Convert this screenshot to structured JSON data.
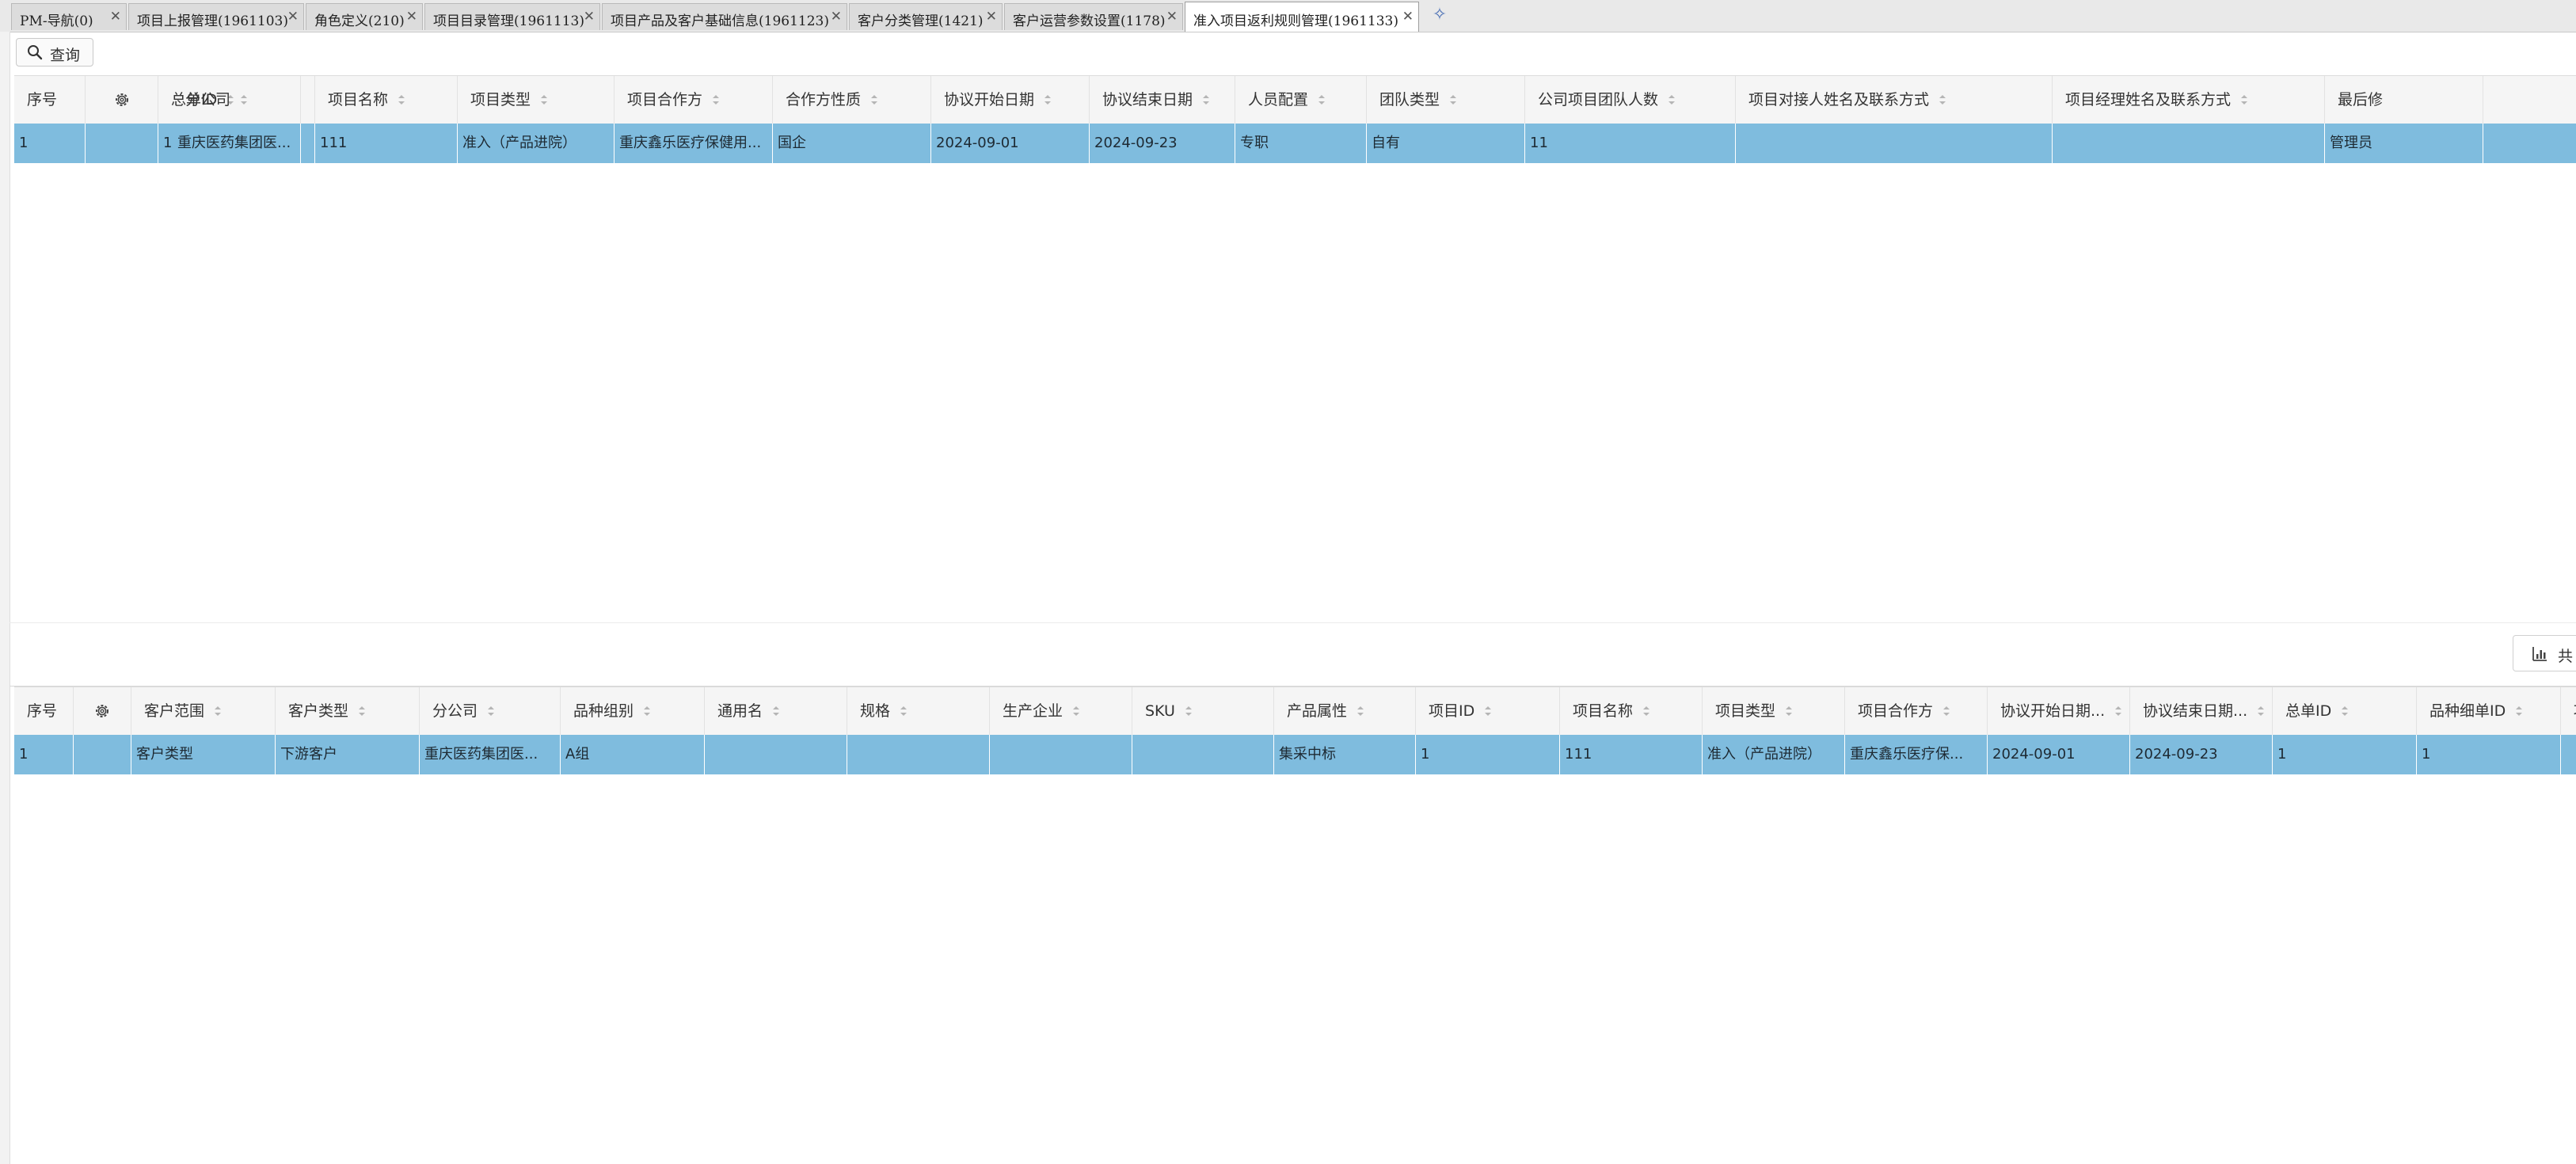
{
  "tabs": [
    {
      "label": "PM-导航(0)",
      "close": "✕"
    },
    {
      "label": "项目上报管理(1961103)",
      "close": "✕"
    },
    {
      "label": "角色定义(210)",
      "close": "✕"
    },
    {
      "label": "项目目录管理(1961113)",
      "close": "✕"
    },
    {
      "label": "项目产品及客户基础信息(1961123)",
      "close": "✕"
    },
    {
      "label": "客户分类管理(1421)",
      "close": "✕"
    },
    {
      "label": "客户运营参数设置(1178)",
      "close": "✕"
    },
    {
      "label": "准入项目返利规则管理(1961133)",
      "close": "✕"
    }
  ],
  "add_tab_icon": "✧",
  "toolbar": {
    "query_label": "查询",
    "query_icon": "search-icon"
  },
  "grid_top": {
    "columns": [
      "序号",
      "",
      "总单ID",
      "分公司",
      "项目名称",
      "项目类型",
      "项目合作方",
      "合作方性质",
      "协议开始日期",
      "协议结束日期",
      "人员配置",
      "团队类型",
      "公司项目团队人数",
      "项目对接人姓名及联系方式",
      "项目经理姓名及联系方式",
      "最后修"
    ],
    "rows": [
      [
        "1",
        "",
        "1",
        "重庆医药集团医...",
        "111",
        "准入（产品进院）",
        "重庆鑫乐医疗保健用...",
        "国企",
        "2024-09-01",
        "2024-09-23",
        "专职",
        "自有",
        "11",
        "",
        "",
        "管理员"
      ]
    ]
  },
  "stats_button": {
    "label": "共",
    "icon": "bar-chart-icon"
  },
  "grid_bottom": {
    "columns": [
      "序号",
      "",
      "客户范围",
      "客户类型",
      "分公司",
      "品种组别",
      "通用名",
      "规格",
      "生产企业",
      "SKU",
      "产品属性",
      "项目ID",
      "项目名称",
      "项目类型",
      "项目合作方",
      "协议开始日期...",
      "协议结束日期...",
      "总单ID",
      "品种细单ID",
      "项"
    ],
    "rows": [
      [
        "1",
        "",
        "客户类型",
        "下游客户",
        "重庆医药集团医...",
        "A组",
        "",
        "",
        "",
        "",
        "集采中标",
        "1",
        "111",
        "准入（产品进院）",
        "重庆鑫乐医疗保...",
        "2024-09-01",
        "2024-09-23",
        "1",
        "1",
        ""
      ]
    ]
  },
  "colors": {
    "selected_row": "#7fbcde",
    "header_bg": "#f5f5f5",
    "tab_bg": "#dcdcdc"
  }
}
